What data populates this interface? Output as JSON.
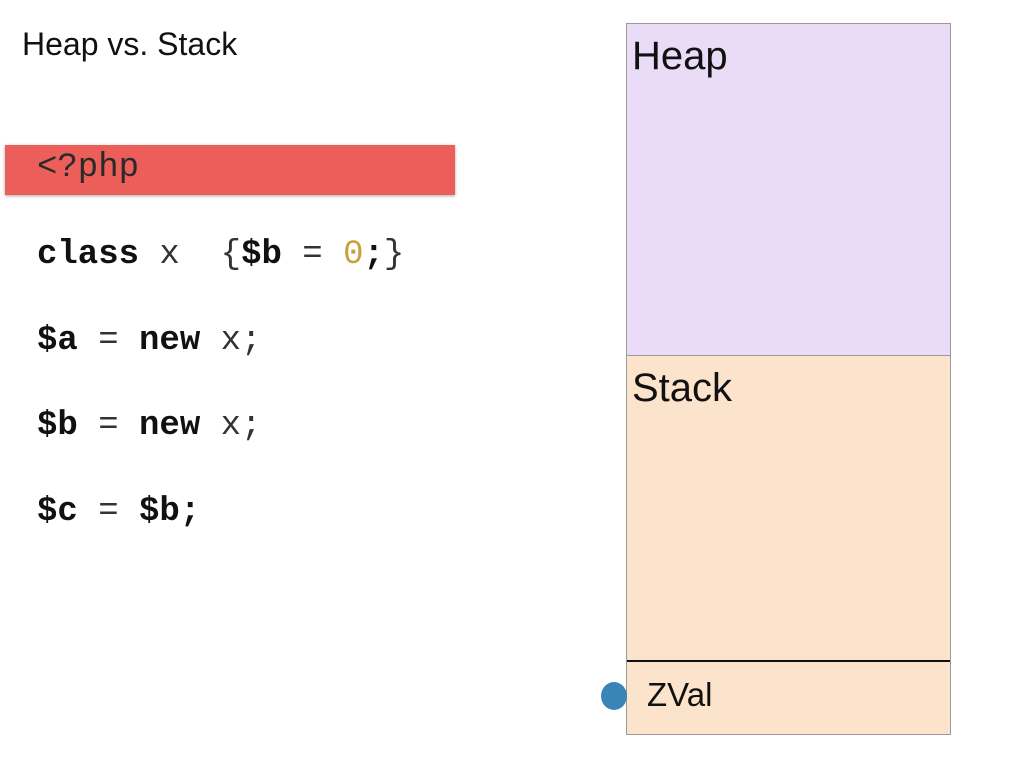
{
  "slide": {
    "title": "Heap vs. Stack"
  },
  "code": {
    "php_open": "<?php",
    "line1": {
      "kw_class": "class",
      "name": " x  {",
      "var": "$b",
      "eq": " = ",
      "value": "0",
      "end": ";",
      "close": "}"
    },
    "line2": {
      "var": "$a",
      "eq": " = ",
      "kw_new": "new",
      "rest": " x;"
    },
    "line3": {
      "var": "$b",
      "eq": " = ",
      "kw_new": "new",
      "rest": " x;"
    },
    "line4": {
      "var": "$c",
      "eq": " = ",
      "rhs": "$b;"
    }
  },
  "memory": {
    "heap_label": "Heap",
    "stack_label": "Stack",
    "zval_label": "ZVal"
  },
  "colors": {
    "php_tag_bg": "#eb5e5a",
    "heap_bg": "#eadcf6",
    "stack_bg": "#fce3cb",
    "number_literal": "#c8a13a",
    "zval_pointer": "#3a85b8"
  }
}
